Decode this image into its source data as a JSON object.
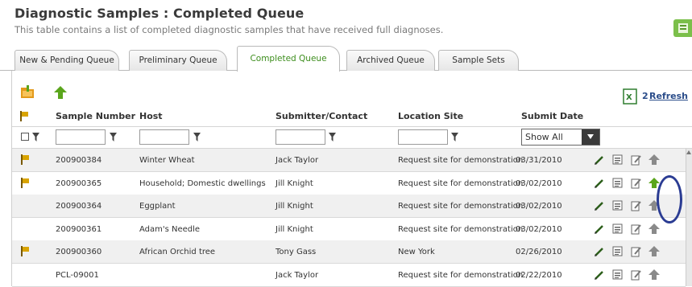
{
  "page": {
    "title": "Diagnostic Samples : Completed Queue",
    "subtitle": "This table contains a list of completed diagnostic samples that have received full diagnoses."
  },
  "tabs": [
    {
      "label": "New & Pending Queue",
      "active": false
    },
    {
      "label": "Preliminary Queue",
      "active": false
    },
    {
      "label": "Completed Queue",
      "active": true
    },
    {
      "label": "Archived Queue",
      "active": false
    },
    {
      "label": "Sample Sets",
      "active": false
    }
  ],
  "toolbar": {
    "refresh_count": "2",
    "refresh_label": "Refresh"
  },
  "table": {
    "columns": [
      "Sample Number",
      "Host",
      "Submitter/Contact",
      "Location Site",
      "Submit Date"
    ],
    "filter_select_value": "Show All",
    "rows": [
      {
        "flag": true,
        "sample": "200900384",
        "host": "Winter Wheat",
        "submitter": "Jack Taylor",
        "location": "Request site for demonstration",
        "date": "03/31/2010",
        "promote_active": false
      },
      {
        "flag": true,
        "sample": "200900365",
        "host": "Household; Domestic dwellings",
        "submitter": "Jill Knight",
        "location": "Request site for demonstration",
        "date": "03/02/2010",
        "promote_active": true
      },
      {
        "flag": false,
        "sample": "200900364",
        "host": "Eggplant",
        "submitter": "Jill Knight",
        "location": "Request site for demonstration",
        "date": "03/02/2010",
        "promote_active": false
      },
      {
        "flag": false,
        "sample": "200900361",
        "host": "Adam's Needle",
        "submitter": "Jill Knight",
        "location": "Request site for demonstration",
        "date": "03/02/2010",
        "promote_active": false
      },
      {
        "flag": true,
        "sample": "200900360",
        "host": "African Orchid tree",
        "submitter": "Tony Gass",
        "location": "New York",
        "date": "02/26/2010",
        "promote_active": false
      },
      {
        "flag": false,
        "sample": "PCL-09001",
        "host": "",
        "submitter": "Jack Taylor",
        "location": "Request site for demonstration",
        "date": "02/22/2010",
        "promote_active": false
      }
    ]
  },
  "colors": {
    "active_tab_text": "#3c8d1c",
    "link": "#2b4d8a",
    "flag": "#d9a400",
    "promote_green": "#5aa51c",
    "promote_gray": "#8a8a8a",
    "highlight": "#2b3c93"
  },
  "icons": {
    "toolbar": [
      "folder-icon",
      "promote-arrow-icon",
      "excel-icon"
    ],
    "row_actions": [
      "edit-pencil-icon",
      "report-icon",
      "edit-document-icon",
      "promote-arrow-icon"
    ]
  }
}
